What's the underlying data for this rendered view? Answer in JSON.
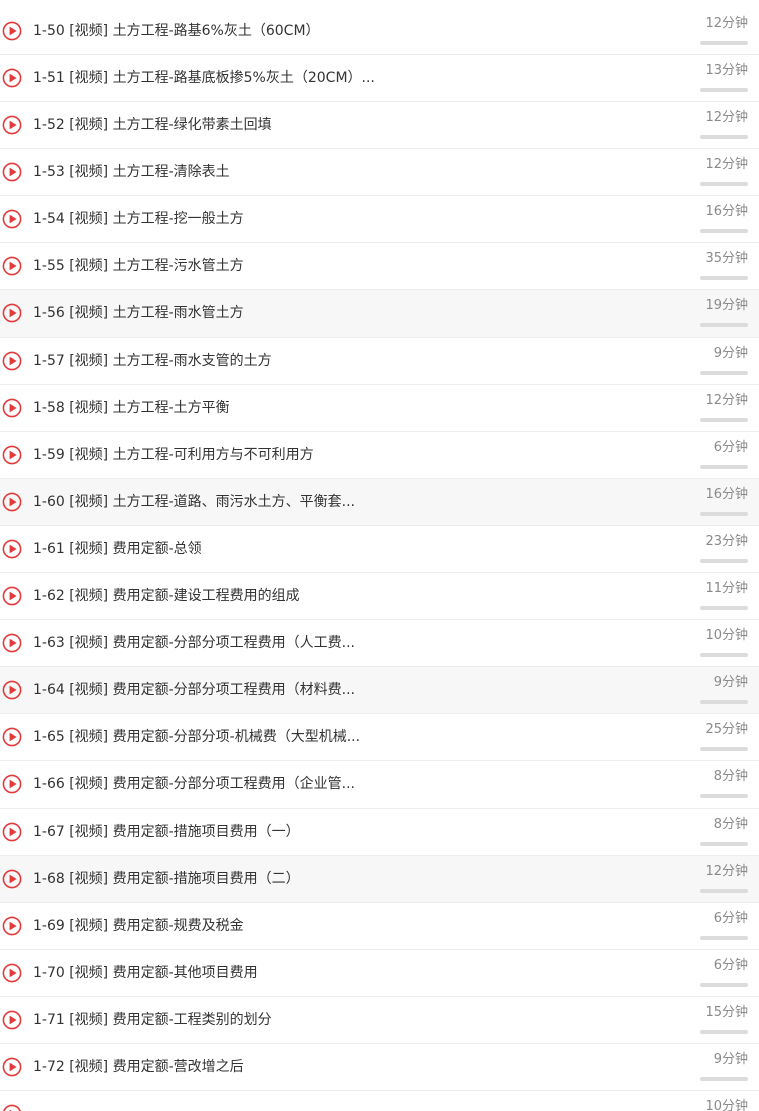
{
  "colors": {
    "play_icon": "#e23b3b",
    "progress_track": "#dcdcdc",
    "title_text": "#333333",
    "duration_text": "#8a8a8a"
  },
  "lessons": [
    {
      "title": "1-50 [视频] 土方工程-路基6%灰土（60CM）",
      "duration": "12分钟",
      "progress": 0
    },
    {
      "title": "1-51 [视频] 土方工程-路基底板掺5%灰土（20CM）...",
      "duration": "13分钟",
      "progress": 0
    },
    {
      "title": "1-52 [视频] 土方工程-绿化带素土回填",
      "duration": "12分钟",
      "progress": 0
    },
    {
      "title": "1-53 [视频] 土方工程-清除表土",
      "duration": "12分钟",
      "progress": 0
    },
    {
      "title": "1-54 [视频] 土方工程-挖一般土方",
      "duration": "16分钟",
      "progress": 0
    },
    {
      "title": "1-55 [视频] 土方工程-污水管土方",
      "duration": "35分钟",
      "progress": 0
    },
    {
      "title": "1-56 [视频] 土方工程-雨水管土方",
      "duration": "19分钟",
      "progress": 0
    },
    {
      "title": "1-57 [视频] 土方工程-雨水支管的土方",
      "duration": "9分钟",
      "progress": 0
    },
    {
      "title": "1-58 [视频] 土方工程-土方平衡",
      "duration": "12分钟",
      "progress": 0
    },
    {
      "title": "1-59 [视频] 土方工程-可利用方与不可利用方",
      "duration": "6分钟",
      "progress": 0
    },
    {
      "title": "1-60 [视频] 土方工程-道路、雨污水土方、平衡套...",
      "duration": "16分钟",
      "progress": 0
    },
    {
      "title": "1-61 [视频] 费用定额-总领",
      "duration": "23分钟",
      "progress": 0
    },
    {
      "title": "1-62 [视频] 费用定额-建设工程费用的组成",
      "duration": "11分钟",
      "progress": 0
    },
    {
      "title": "1-63 [视频] 费用定额-分部分项工程费用（人工费...",
      "duration": "10分钟",
      "progress": 0
    },
    {
      "title": "1-64 [视频] 费用定额-分部分项工程费用（材料费...",
      "duration": "9分钟",
      "progress": 0
    },
    {
      "title": "1-65 [视频] 费用定额-分部分项-机械费（大型机械...",
      "duration": "25分钟",
      "progress": 0
    },
    {
      "title": "1-66 [视频] 费用定额-分部分项工程费用（企业管...",
      "duration": "8分钟",
      "progress": 0
    },
    {
      "title": "1-67 [视频] 费用定额-措施项目费用（一）",
      "duration": "8分钟",
      "progress": 0
    },
    {
      "title": "1-68 [视频] 费用定额-措施项目费用（二）",
      "duration": "12分钟",
      "progress": 0
    },
    {
      "title": "1-69 [视频] 费用定额-规费及税金",
      "duration": "6分钟",
      "progress": 0
    },
    {
      "title": "1-70 [视频] 费用定额-其他项目费用",
      "duration": "6分钟",
      "progress": 0
    },
    {
      "title": "1-71 [视频] 费用定额-工程类别的划分",
      "duration": "15分钟",
      "progress": 0
    },
    {
      "title": "1-72 [视频] 费用定额-营改增之后",
      "duration": "9分钟",
      "progress": 0
    },
    {
      "title": "",
      "duration": "10分钟",
      "progress": 0
    }
  ]
}
